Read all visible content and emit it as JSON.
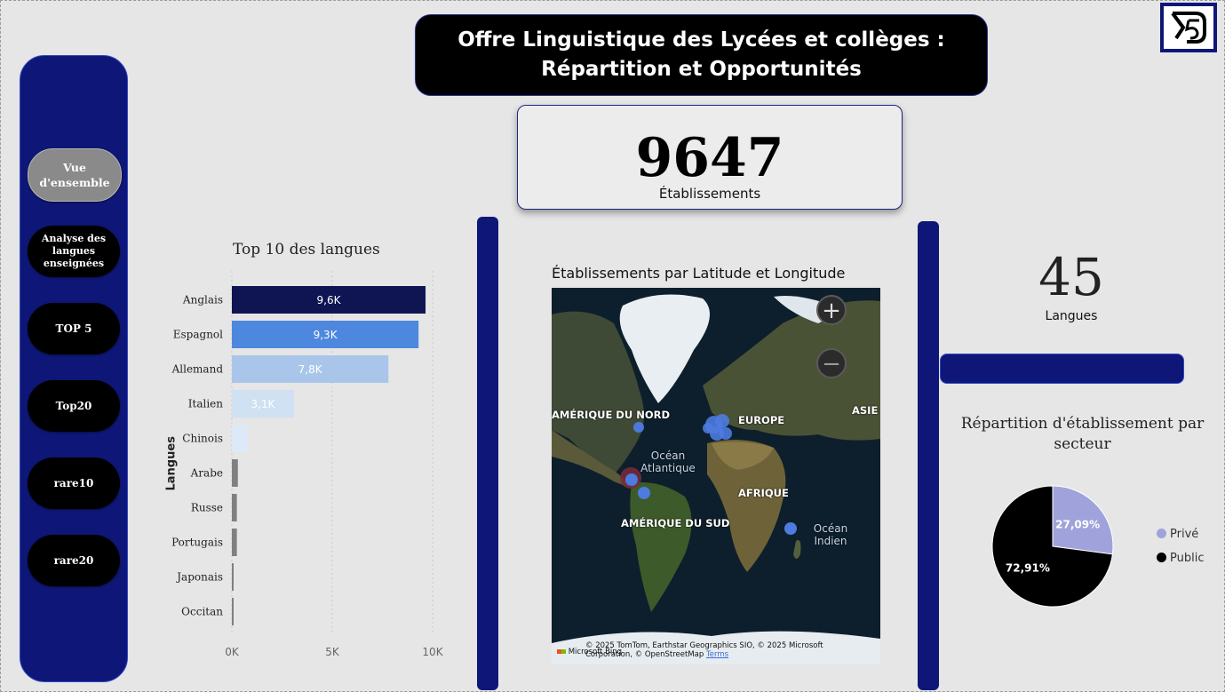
{
  "title": {
    "line1": "Offre Linguistique des Lycées et collèges :",
    "line2": "Répartition et Opportunités"
  },
  "nav": [
    {
      "label": "Vue d'ensemble",
      "active": true
    },
    {
      "label": "Analyse des langues enseignées",
      "active": false
    },
    {
      "label": "TOP 5",
      "active": false
    },
    {
      "label": "Top20",
      "active": false
    },
    {
      "label": "rare10",
      "active": false
    },
    {
      "label": "rare20",
      "active": false
    }
  ],
  "kpi_establishments": {
    "value": "9647",
    "label": "Établissements"
  },
  "kpi_languages": {
    "value": "45",
    "label": "Langues"
  },
  "map": {
    "title": "Établissements par Latitude et Longitude",
    "labels": [
      "AMÉRIQUE DU NORD",
      "EUROPE",
      "ASIE",
      "AFRIQUE",
      "AMÉRIQUE DU SUD"
    ],
    "oceans": [
      "Océan Atlantique",
      "Océan Indien"
    ],
    "zoom_in": "+",
    "zoom_out": "−",
    "copyright": "© 2025 TomTom, Earthstar Geographics SIO, © 2025 Microsoft Corporation, © OpenStreetMap",
    "terms": "Terms",
    "provider": "Microsoft Bing"
  },
  "colors": {
    "sidebar": "#0e1777",
    "dark_bar": "#0f1553",
    "mid_bar": "#4d88de",
    "light_bar": "#a9c6ea",
    "pale_bar": "#cfe1f2",
    "grey_bar": "#808080",
    "prive": "#a0a3db",
    "public": "#000000"
  },
  "chart_data": [
    {
      "type": "bar",
      "orientation": "horizontal",
      "title": "Top 10 des langues",
      "ylabel": "Langues",
      "xlabel": "",
      "categories": [
        "Anglais",
        "Espagnol",
        "Allemand",
        "Italien",
        "Chinois",
        "Arabe",
        "Russe",
        "Portugais",
        "Japonais",
        "Occitan"
      ],
      "values": [
        9647,
        9300,
        7800,
        3100,
        800,
        300,
        250,
        250,
        80,
        70
      ],
      "data_labels": [
        "9,6K",
        "9,3K",
        "7,8K",
        "3,1K",
        "",
        "",
        "",
        "",
        "",
        ""
      ],
      "xticks": [
        "0K",
        "5K",
        "10K"
      ],
      "xlim": [
        0,
        10000
      ],
      "bar_colors": [
        "#0f1553",
        "#4d88de",
        "#a9c6ea",
        "#cfe1f2",
        "#dde9f6",
        "#808080",
        "#808080",
        "#808080",
        "#808080",
        "#808080"
      ]
    },
    {
      "type": "pie",
      "title": "Répartition d'établissement par secteur",
      "categories": [
        "Privé",
        "Public"
      ],
      "values": [
        27.09,
        72.91
      ],
      "data_labels": [
        "27,09%",
        "72,91%"
      ],
      "colors": [
        "#a0a3db",
        "#000000"
      ],
      "legend": "right"
    }
  ]
}
